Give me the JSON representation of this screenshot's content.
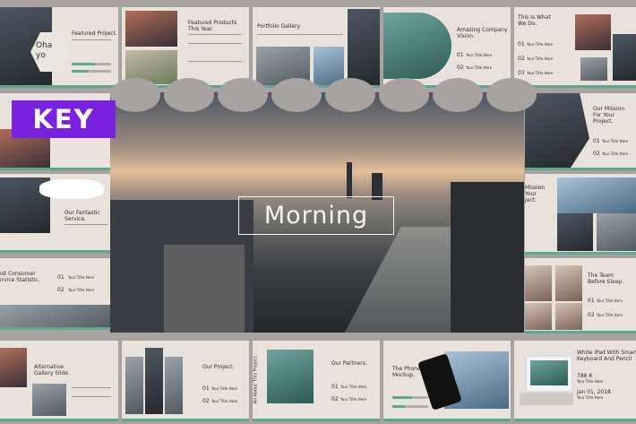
{
  "badge": {
    "label": "KEY"
  },
  "hero": {
    "title": "Morning"
  },
  "slides": {
    "featured_project": {
      "title": "Featured Project.",
      "overlay": "Oha\nyo"
    },
    "featured_products": {
      "title": "Featured Products\nThis Year."
    },
    "portfolio_gallery": {
      "title": "Portfolio Gallery."
    },
    "company_vision": {
      "title": "Amazing Company\nVision.",
      "n1": "01",
      "n2": "02",
      "item1": "Your Title Here",
      "item2": "Your Title Here"
    },
    "what_we_do": {
      "title": "This Is What\nWe Do.",
      "n1": "01",
      "n2": "02",
      "n3": "03",
      "item1": "Your Title Here",
      "item2": "Your Title Here",
      "item3": "Your Title Here"
    },
    "mission": {
      "title": "Our Mission\nFor Your\nProject.",
      "n1": "01",
      "n2": "02",
      "item1": "Your Title Here",
      "item2": "Your Title Here"
    },
    "mission_partial": {
      "title": "Mission\nYour\nject."
    },
    "fantastic_service": {
      "title": "Our Fantastic\nService."
    },
    "consumer_stat": {
      "title": "est Consumer\nervice Statistic.",
      "n1": "01",
      "n2": "02",
      "item1": "Your Title Here",
      "item2": "Your Title Here"
    },
    "team": {
      "title": "The Team\nBefore Sleep.",
      "n1": "01",
      "n2": "02",
      "item1": "Your Title Here",
      "item2": "Your Title Here"
    },
    "alt_gallery": {
      "title": "Alternative\nGallery Slide."
    },
    "our_project": {
      "title": "Our Project.",
      "n1": "01",
      "n2": "02",
      "item1": "Your Title Here",
      "item2": "Your Title Here"
    },
    "all_about": {
      "title": "All About This Project."
    },
    "partners": {
      "title": "Our Partners.",
      "n1": "01",
      "n2": "02",
      "item1": "Your Title Here",
      "item2": "Your Title Here"
    },
    "phone_mockup": {
      "title": "The Phone\nMockup."
    },
    "ipad": {
      "title": "White iPad With Smart\nKeyboard And Pencil",
      "price": "786 K",
      "price_label": "Your Title Here",
      "date": "Jan 01, 2018",
      "date_label": "Your Title Here"
    }
  },
  "colors": {
    "accent": "#5fa88e",
    "badge": "#7a22e0",
    "slide_bg": "#e9e1dc"
  }
}
